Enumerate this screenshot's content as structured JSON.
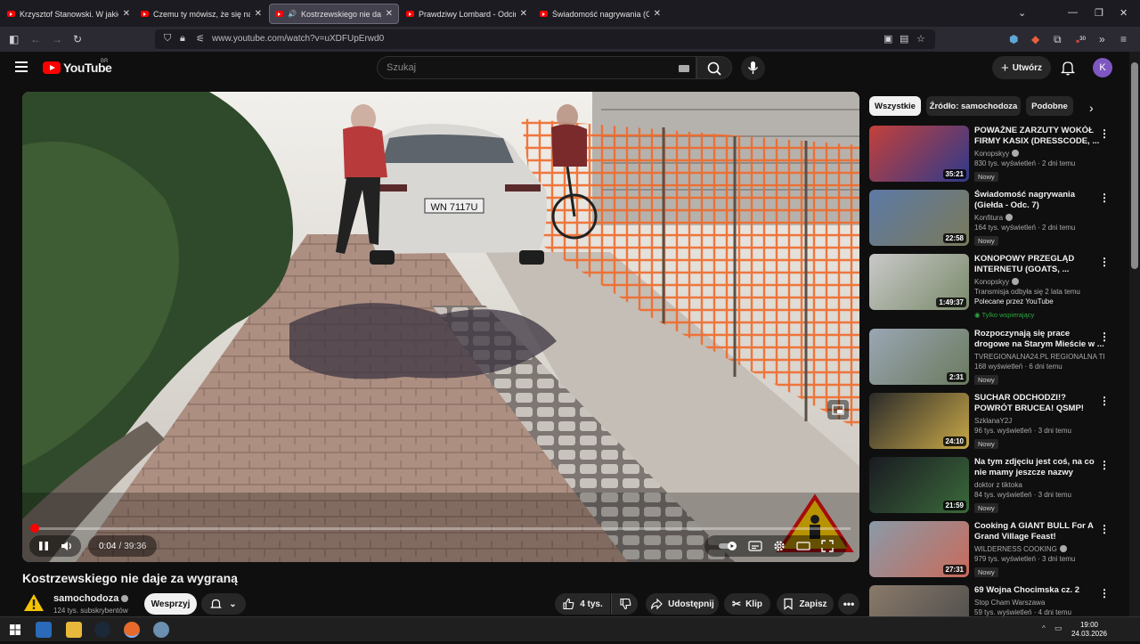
{
  "browser": {
    "tabs": [
      {
        "title": "Krzysztof Stanowski. W jakiej sp",
        "active": false
      },
      {
        "title": "Czemu ty mówisz, że się na ciebi",
        "active": false
      },
      {
        "title": "Kostrzewskiego nie daje za",
        "active": true,
        "audio": true
      },
      {
        "title": "Prawdziwy Lombard - Odcinek",
        "active": false
      },
      {
        "title": "Świadomość nagrywania (Giełd",
        "active": false
      }
    ],
    "url": "www.youtube.com/watch?v=uXDFUpErwd0",
    "extension_badge": "30"
  },
  "youtube": {
    "logo_text": "YouTube",
    "country_code": "BR",
    "search_placeholder": "Szukaj",
    "create_label": "Utwórz",
    "avatar_letter": "K"
  },
  "player": {
    "current_time": "0:04",
    "separator": "/",
    "duration": "39:36",
    "progress_fraction": 0.0017,
    "plate": "WN 7117U"
  },
  "video": {
    "title": "Kostrzewskiego nie daje za wygraną",
    "channel": "samochodoza",
    "subscribers": "124 tys. subskrybentów",
    "support_label": "Wesprzyj",
    "likes": "4 tys.",
    "share_label": "Udostępnij",
    "clip_label": "Klip",
    "save_label": "Zapisz"
  },
  "sidebar": {
    "chips": [
      "Wszystkie",
      "Źródło: samochodoza",
      "Podobne"
    ],
    "recommendations": [
      {
        "title": "POWAŻNE ZARZUTY WOKÓŁ FIRMY KASIX (DRESSCODE, ...",
        "channel": "Konopskyy",
        "verified": true,
        "meta": "830 tys. wyświetleń · 2 dni temu",
        "badge": "Nowy",
        "duration": "35:21",
        "thumb": [
          "#c4403a",
          "#2e3a8c"
        ]
      },
      {
        "title": "Świadomość nagrywania (Giełda - Odc. 7)",
        "channel": "Konfitura",
        "verified": true,
        "meta": "164 tys. wyświetleń · 2 dni temu",
        "badge": "Nowy",
        "duration": "22:58",
        "thumb": [
          "#5d7aa6",
          "#7a7a5a"
        ]
      },
      {
        "title": "KONOPOWY PRZEGLĄD INTERNETU (GOATS, ...",
        "channel": "Konopskyy",
        "verified": true,
        "meta": "Transmisja odbyła się 2 lata temu",
        "badge": "",
        "promo": "Polecane przez YouTube",
        "members": "Tylko wspierający",
        "duration": "1:49:37",
        "thumb": [
          "#c9c9c9",
          "#7a8a6a"
        ]
      },
      {
        "title": "Rozpoczynają się prace drogowe na Starym Mieście w ...",
        "channel": "TVREGIONALNA24.PL REGIONALNA TE...",
        "verified": false,
        "meta": "168 wyświetleń · 6 dni temu",
        "badge": "Nowy",
        "duration": "2:31",
        "thumb": [
          "#9aa6b4",
          "#6b7a5e"
        ]
      },
      {
        "title": "SUCHAR ODCHODZI!? POWRÓT BRUCEA! QSMP! PATIRO! ...",
        "channel": "SzklanaY2J",
        "verified": false,
        "meta": "96 tys. wyświetleń · 3 dni temu",
        "badge": "Nowy",
        "duration": "24:10",
        "thumb": [
          "#2a2a2a",
          "#c8a848"
        ]
      },
      {
        "title": "Na tym zdjęciu jest coś, na co nie mamy jeszcze nazwy",
        "channel": "doktor z tiktoka",
        "verified": false,
        "meta": "84 tys. wyświetleń · 3 dni temu",
        "badge": "Nowy",
        "duration": "21:59",
        "thumb": [
          "#1a1a22",
          "#3a6a3a"
        ]
      },
      {
        "title": "Cooking A GIANT BULL For A Grand Village Feast!",
        "channel": "WILDERNESS COOKING",
        "verified": true,
        "meta": "979 tys. wyświetleń · 3 dni temu",
        "badge": "Nowy",
        "duration": "27:31",
        "thumb": [
          "#8a9aa8",
          "#c86a5a"
        ]
      },
      {
        "title": "69 Wojna Chocimska cz. 2",
        "channel": "Stop Cham Warszawa",
        "verified": false,
        "meta": "59 tys. wyświetleń · 4 dni temu",
        "badge": "",
        "duration": "",
        "thumb": [
          "#8a7a6a",
          "#4a4a4a"
        ]
      }
    ]
  },
  "taskbar": {
    "time": "19:00",
    "date": "24.03.2026"
  },
  "colors": {
    "youtube_red": "#ff0000",
    "background": "#0f0f0f",
    "chip": "#272727"
  }
}
